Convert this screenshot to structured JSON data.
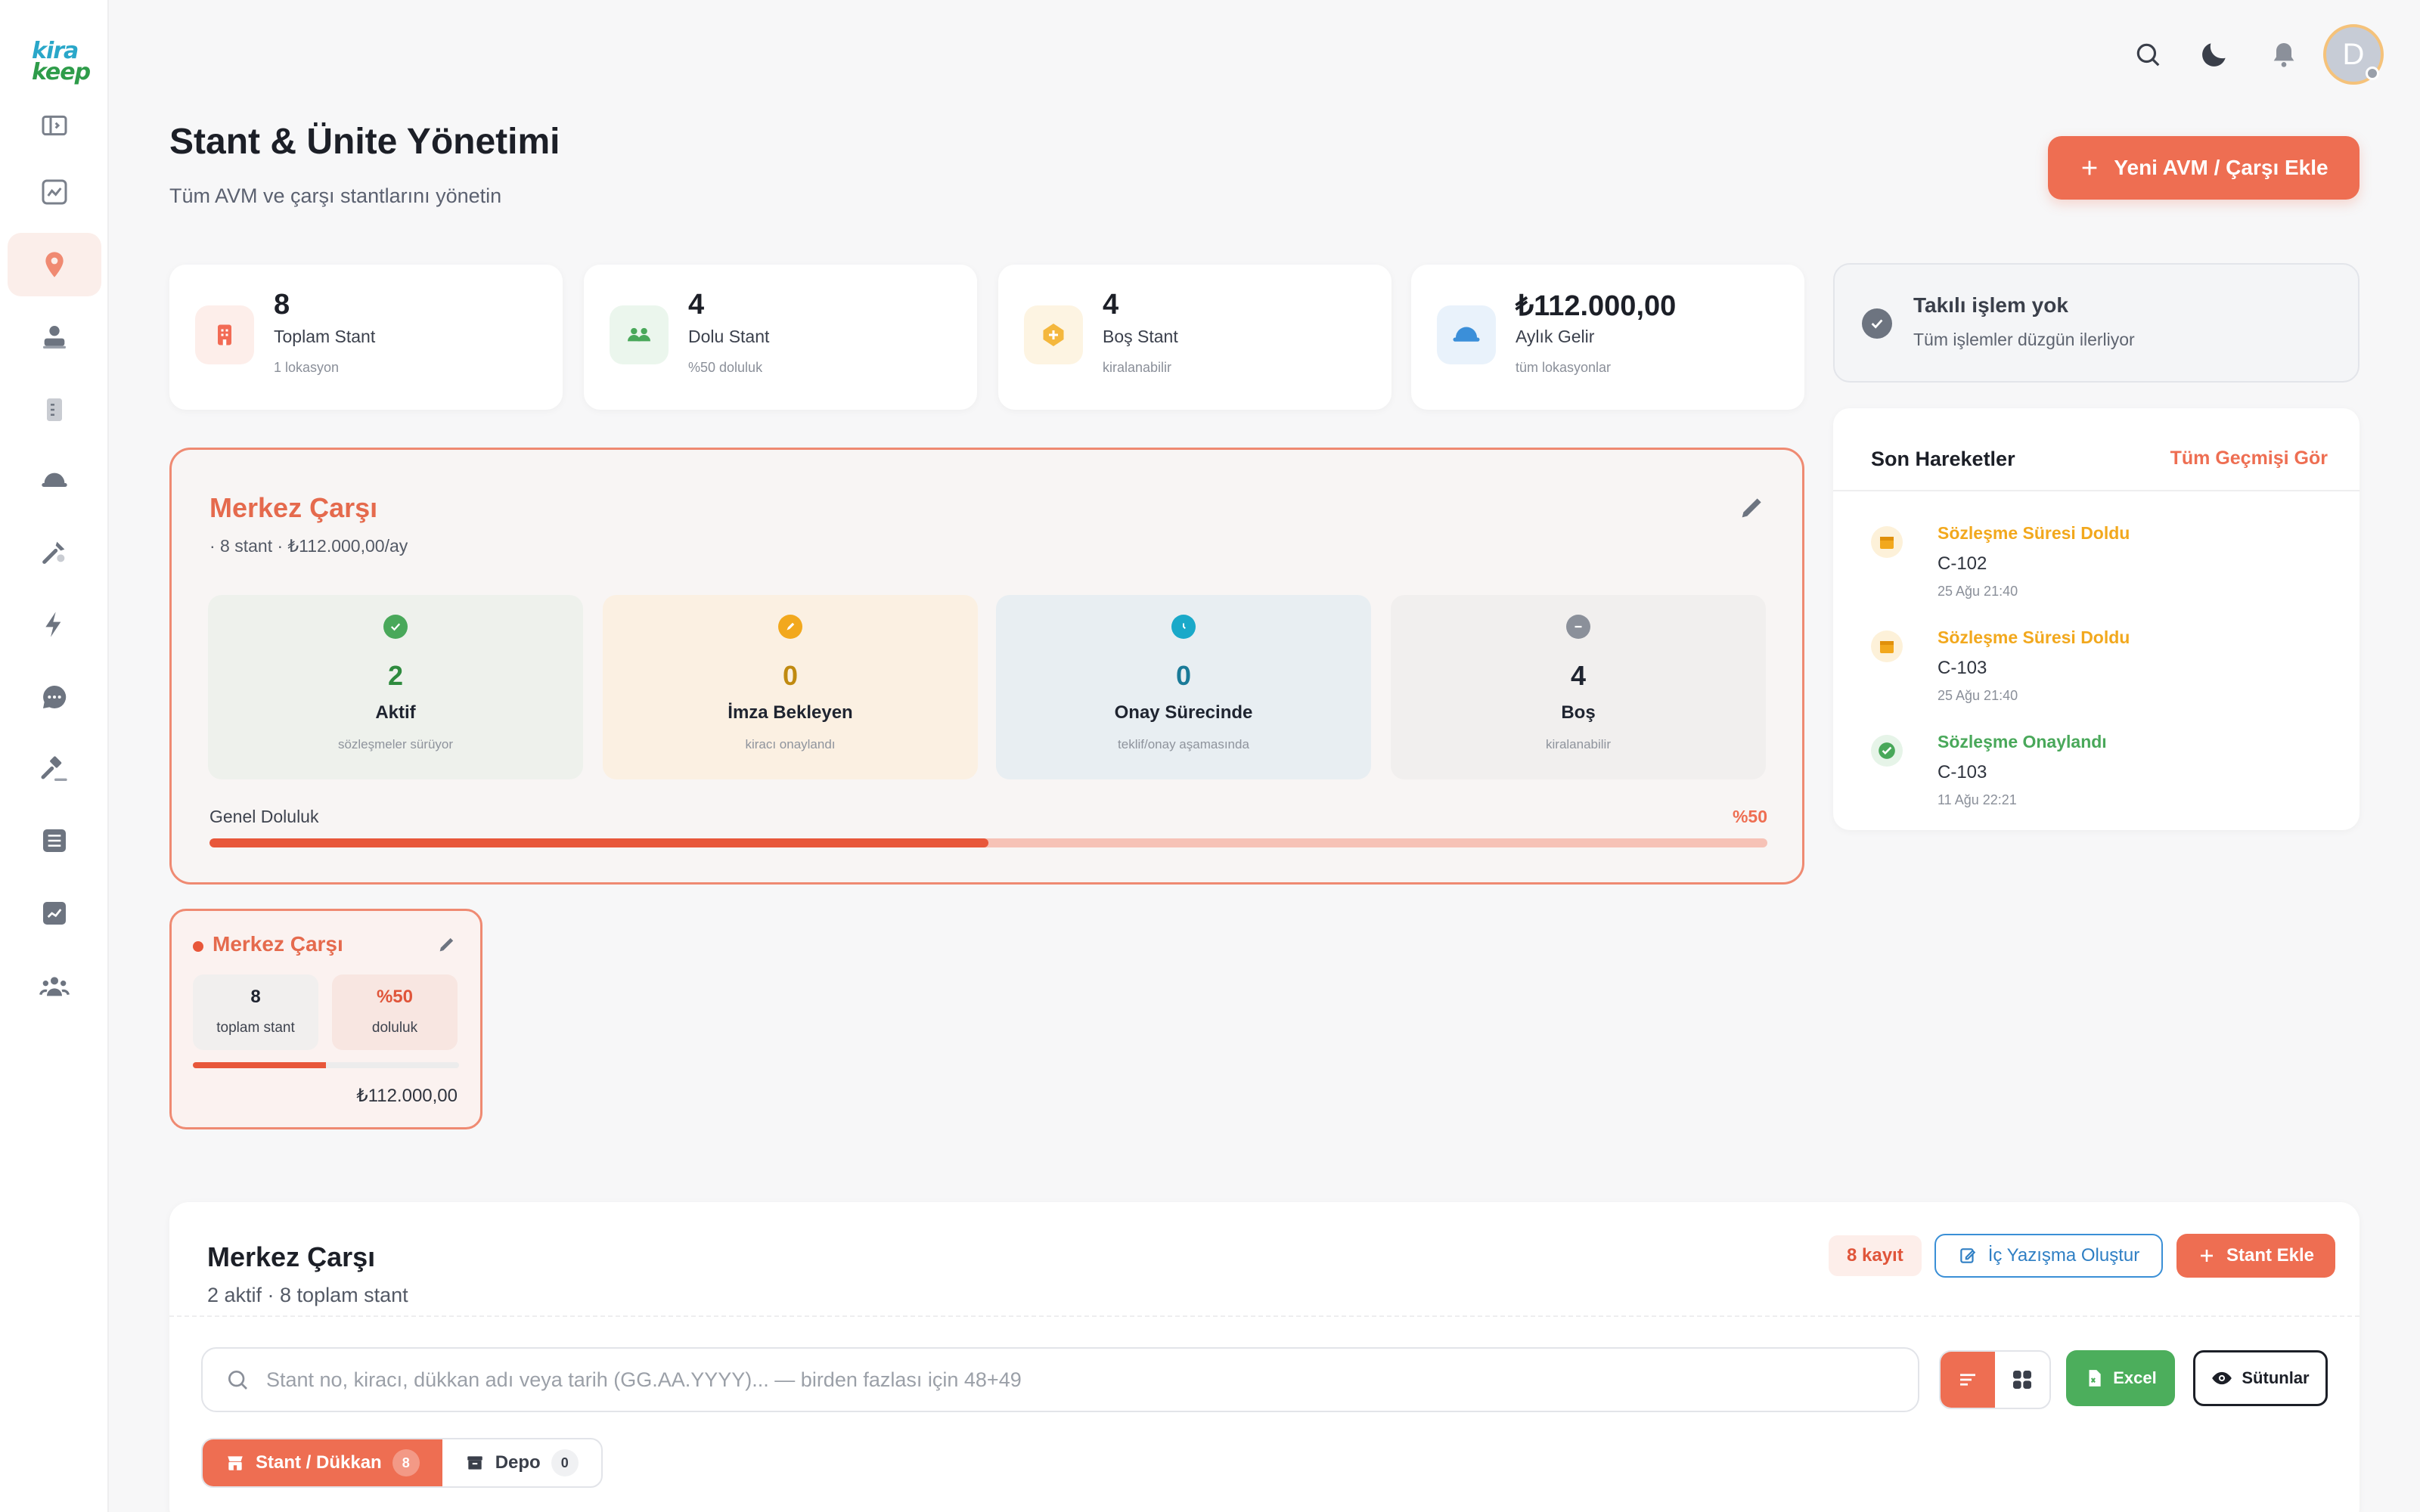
{
  "brand": {
    "logo_top": "kira",
    "logo_bottom": "keep"
  },
  "sidebar": {
    "items": [
      {
        "icon": "sidebar-toggle-icon"
      },
      {
        "icon": "chart-icon"
      },
      {
        "icon": "location-pin-icon",
        "active": true
      },
      {
        "icon": "user-stamp-icon"
      },
      {
        "icon": "document-icon"
      },
      {
        "icon": "helmet-icon"
      },
      {
        "icon": "tools-icon"
      },
      {
        "icon": "lightning-icon"
      },
      {
        "icon": "chat-icon"
      },
      {
        "icon": "gavel-icon"
      },
      {
        "icon": "list-icon"
      },
      {
        "icon": "trend-icon"
      },
      {
        "icon": "users-icon"
      }
    ]
  },
  "topbar": {
    "avatar_initial": "D"
  },
  "header": {
    "title": "Stant & Ünite Yönetimi",
    "subtitle": "Tüm AVM ve çarşı stantlarını yönetin",
    "add_button": "Yeni AVM / Çarşı Ekle"
  },
  "stats": [
    {
      "value": "8",
      "label": "Toplam Stant",
      "sub": "1 lokasyon",
      "color": "#f26b55"
    },
    {
      "value": "4",
      "label": "Dolu Stant",
      "sub": "%50 doluluk",
      "color": "#49a85a"
    },
    {
      "value": "4",
      "label": "Boş Stant",
      "sub": "kiralanabilir",
      "color": "#f4b73d"
    },
    {
      "value": "₺112.000,00",
      "label": "Aylık Gelir",
      "sub": "tüm lokasyonlar",
      "color": "#3b8fd9"
    }
  ],
  "alert": {
    "title": "Takılı işlem yok",
    "subtitle": "Tüm işlemler düzgün ilerliyor"
  },
  "recent": {
    "title": "Son Hareketler",
    "link": "Tüm Geçmişi Gör",
    "events": [
      {
        "title": "Sözleşme Süresi Doldu",
        "code": "C-102",
        "date": "25 Ağu 21:40",
        "color": "#f2a81d"
      },
      {
        "title": "Sözleşme Süresi Doldu",
        "code": "C-103",
        "date": "25 Ağu 21:40",
        "color": "#f2a81d"
      },
      {
        "title": "Sözleşme Onaylandı",
        "code": "C-103",
        "date": "11 Ağu 22:21",
        "color": "#49a85a"
      }
    ]
  },
  "location": {
    "name": "Merkez Çarşı",
    "meta": "· 8 stant · ₺112.000,00/ay",
    "boxes": [
      {
        "value": "2",
        "label": "Aktif",
        "sub": "sözleşmeler sürüyor",
        "color": "#2e8b3e",
        "bg": "#eef1ec",
        "icon_color": "#49a85a"
      },
      {
        "value": "0",
        "label": "İmza Bekleyen",
        "sub": "kiracı onaylandı",
        "color": "#c08a10",
        "bg": "#fbf0e2",
        "icon_color": "#f2a81d"
      },
      {
        "value": "0",
        "label": "Onay Sürecinde",
        "sub": "teklif/onay aşamasında",
        "color": "#1a7a98",
        "bg": "#e8eef2",
        "icon_color": "#1aa9c9"
      },
      {
        "value": "4",
        "label": "Boş",
        "sub": "kiralanabilir",
        "color": "#1f2430",
        "bg": "#f1efee",
        "icon_color": "#8b909a"
      }
    ],
    "occupancy_label": "Genel Doluluk",
    "occupancy_value": "%50",
    "occupancy_pct": 50
  },
  "mini_card": {
    "name": "Merkez Çarşı",
    "total_value": "8",
    "total_label": "toplam stant",
    "occ_value": "%50",
    "occ_label": "doluluk",
    "occ_pct": 50,
    "revenue": "₺112.000,00"
  },
  "table": {
    "title": "Merkez Çarşı",
    "subtitle": "2 aktif · 8 toplam stant",
    "count_badge": "8 kayıt",
    "memo_button": "İç Yazışma Oluştur",
    "add_button": "Stant Ekle",
    "search_placeholder": "Stant no, kiracı, dükkan adı veya tarih (GG.AA.YYYY)... — birden fazlası için 48+49",
    "excel_button": "Excel",
    "columns_button": "Sütunlar",
    "tabs": [
      {
        "label": "Stant / Dükkan",
        "count": "8",
        "active": true
      },
      {
        "label": "Depo",
        "count": "0",
        "active": false
      }
    ]
  },
  "colors": {
    "accent": "#ee6e52",
    "blue": "#3a8fd6",
    "green": "#4cae5c"
  }
}
